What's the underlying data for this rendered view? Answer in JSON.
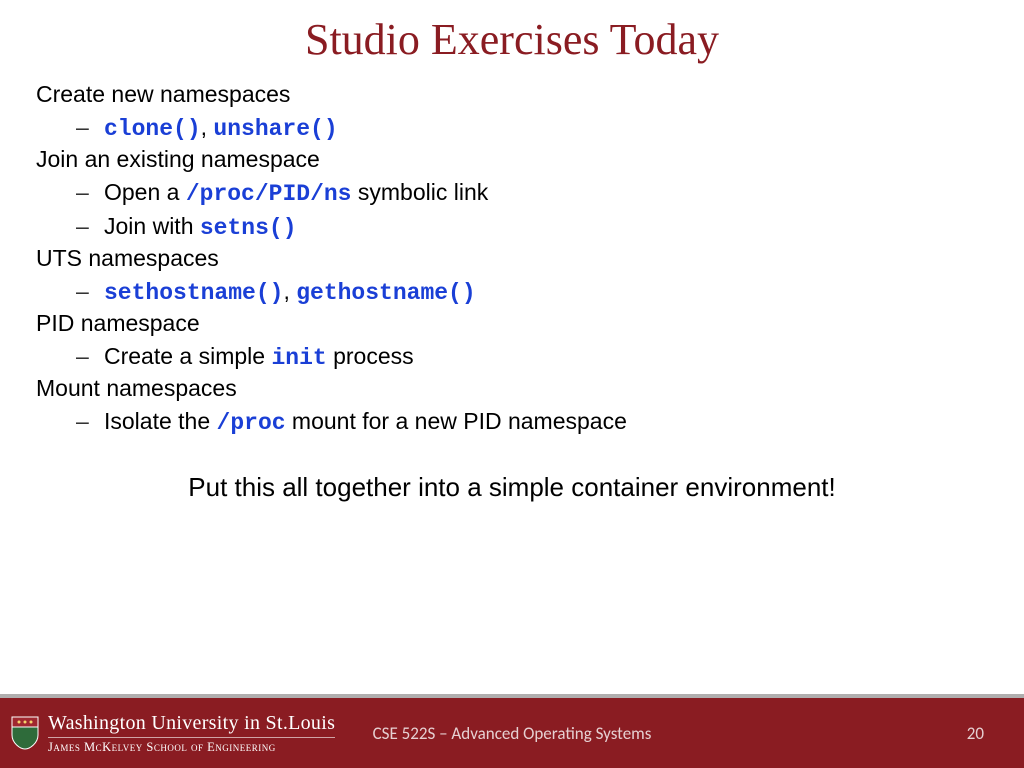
{
  "title": "Studio Exercises Today",
  "sections": {
    "s1": {
      "heading": "Create new namespaces",
      "sub1_code1": "clone()",
      "sub1_sep": ", ",
      "sub1_code2": "unshare()"
    },
    "s2": {
      "heading": "Join an existing namespace",
      "sub1_pre": "Open a ",
      "sub1_code": "/proc/PID/ns",
      "sub1_post": " symbolic link",
      "sub2_pre": "Join with ",
      "sub2_code": "setns()"
    },
    "s3": {
      "heading": "UTS namespaces",
      "sub1_code1": "sethostname()",
      "sub1_sep": ", ",
      "sub1_code2": "gethostname()"
    },
    "s4": {
      "heading": "PID namespace",
      "sub1_pre": "Create a simple ",
      "sub1_code": "init",
      "sub1_post": " process"
    },
    "s5": {
      "heading": "Mount namespaces",
      "sub1_pre": "Isolate the ",
      "sub1_code": "/proc",
      "sub1_post": " mount for a new PID namespace"
    }
  },
  "summary": "Put this all together into a simple container environment!",
  "footer": {
    "logo_main": "Washington University in St.Louis",
    "logo_sub": "James McKelvey School of Engineering",
    "center": "CSE 522S – Advanced Operating Systems",
    "page": "20"
  }
}
